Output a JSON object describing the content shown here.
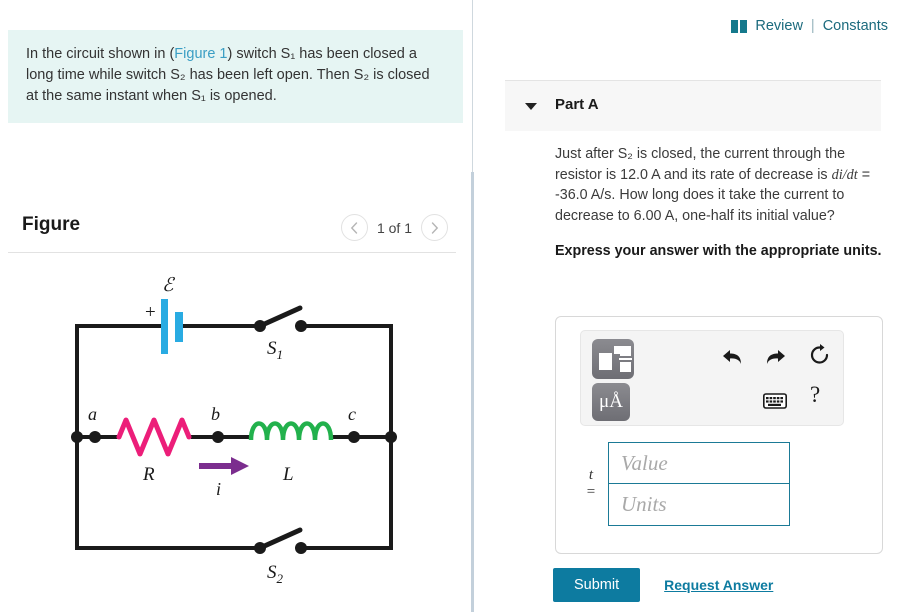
{
  "left": {
    "question": {
      "pre_link": "In the circuit shown in (",
      "link_text": "Figure 1",
      "post_link": ") switch S₁ has been closed a long time while switch S₂ has been left open. Then S₂ is closed at the same instant when S₁ is opened."
    },
    "figure": {
      "title": "Figure",
      "counter": "1 of 1",
      "prev_icon": "chevron-left-icon",
      "next_icon": "chevron-right-icon"
    },
    "circuit": {
      "emf_label": "ℰ",
      "plus_sign": "+",
      "switch1_label": "S₁",
      "switch2_label": "S₂",
      "node_a": "a",
      "node_b": "b",
      "node_c": "c",
      "resistor_label": "R",
      "inductor_label": "L",
      "current_label": "i",
      "colors": {
        "battery": "#29ABE2",
        "resistor": "#EC1E79",
        "inductor": "#22B14C",
        "current_arrow": "#7B2D8E",
        "wire": "#1a1a1a"
      }
    }
  },
  "right": {
    "review": {
      "book_icon": "book-icon",
      "review_label": "Review",
      "separator": "|",
      "constants_label": "Constants"
    },
    "part": {
      "caret_icon": "caret-down-icon",
      "title": "Part A",
      "question_line1": "Just after S₂ is closed, the current through the resistor is 12.0 A and its rate of decrease is ",
      "question_didt": "di/dt",
      "question_line2": " = -36.0 A/s. How long does it take the current to decrease to 6.00 A, one-half its initial value?",
      "instruction": "Express your answer with the appropriate units."
    },
    "toolbar": {
      "template_icon": "math-template-icon",
      "units_icon": "micro-angstrom-units-icon",
      "units_label": "μÅ",
      "undo_icon": "undo-icon",
      "redo_icon": "redo-icon",
      "reset_icon": "reset-icon",
      "keyboard_icon": "keyboard-icon",
      "help_icon": "help-icon",
      "help_label": "?"
    },
    "answer": {
      "variable": "t",
      "equals": "=",
      "value_placeholder": "Value",
      "value": "",
      "units_placeholder": "Units",
      "units": ""
    },
    "actions": {
      "submit_label": "Submit",
      "request_label": "Request Answer"
    },
    "accent_color": "#0d7ba0"
  }
}
